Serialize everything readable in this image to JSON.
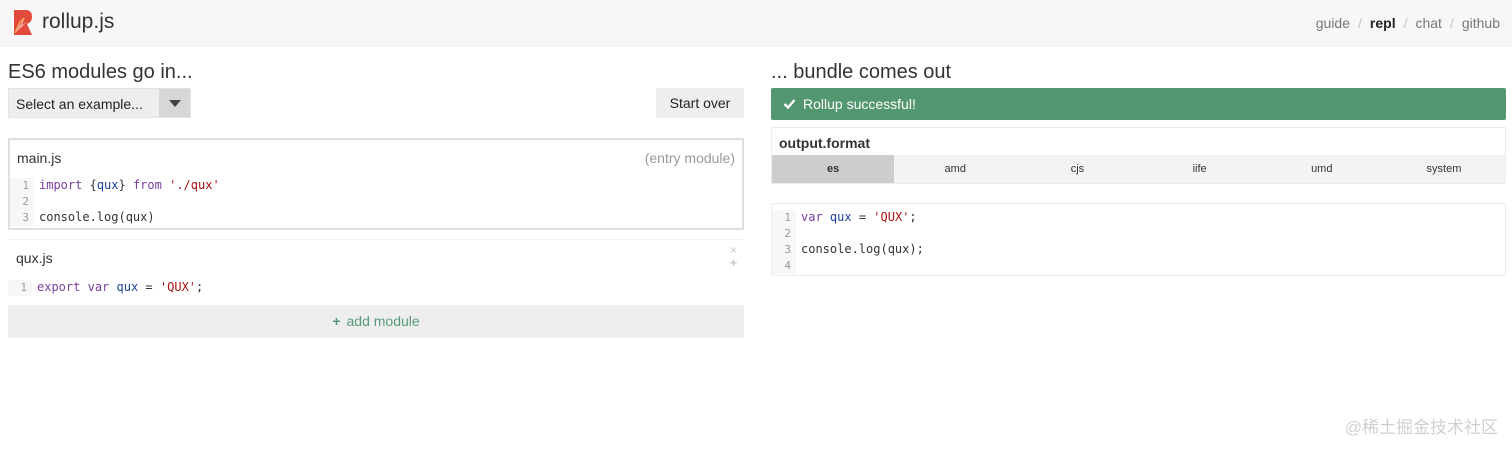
{
  "header": {
    "brand": "rollup.js",
    "nav": [
      {
        "label": "guide",
        "active": false
      },
      {
        "label": "repl",
        "active": true
      },
      {
        "label": "chat",
        "active": false
      },
      {
        "label": "github",
        "active": false
      }
    ],
    "separator": "/",
    "logo_color": "#e24b3b"
  },
  "input_panel": {
    "title": "ES6 modules go in...",
    "example_select": {
      "value": "Select an example...",
      "icon": "chevron-down-icon"
    },
    "start_over_label": "Start over",
    "modules": [
      {
        "name": "main.js",
        "entry_label": "(entry module)",
        "lines": [
          {
            "no": "1",
            "tokens": [
              [
                "kw",
                "import"
              ],
              [
                "txt",
                " {"
              ],
              [
                "var",
                "qux"
              ],
              [
                "txt",
                "} "
              ],
              [
                "kw",
                "from"
              ],
              [
                "txt",
                " "
              ],
              [
                "str",
                "'./qux'"
              ]
            ]
          },
          {
            "no": "2",
            "tokens": []
          },
          {
            "no": "3",
            "tokens": [
              [
                "txt",
                "console.log(qux)"
              ]
            ]
          }
        ]
      },
      {
        "name": "qux.js",
        "close_icon": "×",
        "plus_icon": "+",
        "lines": [
          {
            "no": "1",
            "tokens": [
              [
                "kw",
                "export"
              ],
              [
                "txt",
                " "
              ],
              [
                "kw",
                "var"
              ],
              [
                "txt",
                " "
              ],
              [
                "var",
                "qux"
              ],
              [
                "txt",
                " = "
              ],
              [
                "str",
                "'QUX'"
              ],
              [
                "txt",
                ";"
              ]
            ]
          }
        ]
      }
    ],
    "add_module_icon": "+",
    "add_module_label": "add module"
  },
  "output_panel": {
    "title": "... bundle comes out",
    "status": {
      "text": "Rollup successful!",
      "color": "#52976f",
      "icon": "check-icon"
    },
    "output_format": {
      "label": "output.format",
      "options": [
        "es",
        "amd",
        "cjs",
        "iife",
        "umd",
        "system"
      ],
      "selected": "es"
    },
    "code_lines": [
      {
        "no": "1",
        "tokens": [
          [
            "kw",
            "var"
          ],
          [
            "txt",
            " "
          ],
          [
            "var",
            "qux"
          ],
          [
            "txt",
            " = "
          ],
          [
            "str",
            "'QUX'"
          ],
          [
            "txt",
            ";"
          ]
        ]
      },
      {
        "no": "2",
        "tokens": []
      },
      {
        "no": "3",
        "tokens": [
          [
            "txt",
            "console.log(qux);"
          ]
        ]
      },
      {
        "no": "4",
        "tokens": []
      }
    ]
  },
  "watermark": "@稀土掘金技术社区"
}
